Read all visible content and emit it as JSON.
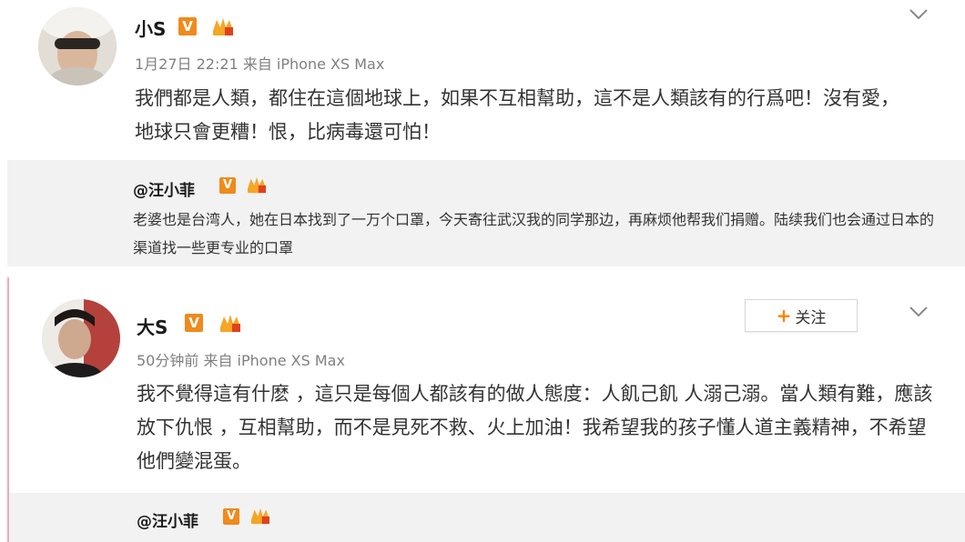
{
  "post1": {
    "username": "小S",
    "v_badge": "V",
    "time": "1月27日 22:21",
    "source": "来自 iPhone XS Max",
    "text": "我們都是人類，都住在這個地球上，如果不互相幫助，這不是人類該有的行爲吧！沒有愛，地球只會更糟！恨，比病毒還可怕！"
  },
  "repost1": {
    "username": "@汪小菲",
    "v_badge": "V",
    "text": "老婆也是台湾人，她在日本找到了一万个口罩，今天寄往武汉我的同学那边，再麻烦他帮我们捐赠。陆续我们也会通过日本的渠道找一些更专业的口罩"
  },
  "post2": {
    "username": "大S",
    "v_badge": "V",
    "time": "50分钟前",
    "source": "来自 iPhone XS Max",
    "follow_plus": "+",
    "follow_label": "关注",
    "text": "我不覺得這有什麽 ，這只是每個人都該有的做人態度：人飢己飢 人溺己溺。當人類有難，應該放下仇恨 ，互相幫助，而不是見死不救、火上加油！我希望我的孩子懂人道主義精神，不希望他們變混蛋。"
  },
  "repost2": {
    "username": "@汪小菲",
    "v_badge": "V"
  },
  "colors": {
    "accent_orange": "#ff8200",
    "v_badge": "#f08a1c",
    "repost_bg": "#f2f2f2",
    "meta_gray": "#808080"
  },
  "icons": [
    "chevron-down-icon",
    "v-verified-icon",
    "member-level-icon",
    "avatar"
  ]
}
